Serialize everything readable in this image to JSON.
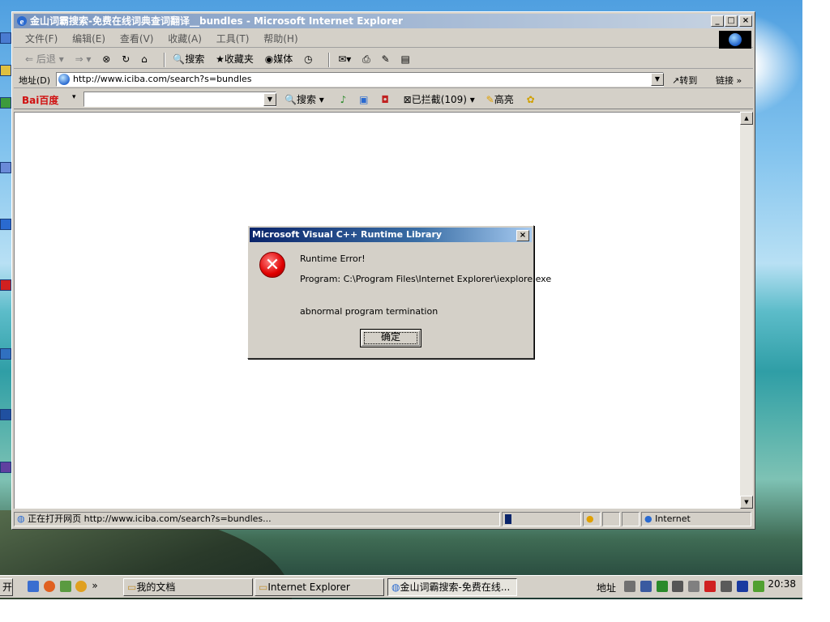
{
  "window": {
    "title": "金山词霸搜索-免费在线词典查词翻译__bundles - Microsoft Internet Explorer",
    "controls": {
      "minimize": "_",
      "maximize": "□",
      "close": "×"
    }
  },
  "menu": [
    "文件(F)",
    "编辑(E)",
    "查看(V)",
    "收藏(A)",
    "工具(T)",
    "帮助(H)"
  ],
  "toolbar": {
    "back": "后退",
    "search": "搜索",
    "favorites": "收藏夹",
    "media": "媒体"
  },
  "address": {
    "label": "地址(D)",
    "url": "http://www.iciba.com/search?s=bundles",
    "go": "转到",
    "links": "链接"
  },
  "baidu": {
    "logo": "Bai百度",
    "search": "搜索",
    "blocked": "已拦截(109)",
    "highlight": "高亮"
  },
  "status": {
    "text": "正在打开网页 http://www.iciba.com/search?s=bundles...",
    "zone": "Internet"
  },
  "dialog": {
    "title": "Microsoft Visual C++ Runtime Library",
    "line1": "Runtime Error!",
    "line2": "Program: C:\\Program Files\\Internet Explorer\\iexplore.exe",
    "line3": "abnormal program termination",
    "ok": "确定"
  },
  "taskbar": {
    "start_partial": "开始",
    "more": "»",
    "tasks": [
      "我的文档",
      "Internet Explorer",
      "金山词霸搜索-免费在线..."
    ],
    "address_label": "地址",
    "clock": "20:38"
  },
  "colors": {
    "dialog_title": "#0a246a",
    "ie_title_inactive": "#7a96c0",
    "error_red": "#e00000"
  }
}
